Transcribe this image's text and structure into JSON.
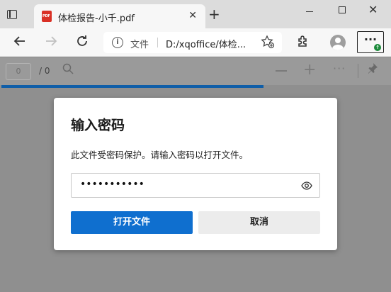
{
  "tab": {
    "title": "体检报告-小千.pdf",
    "icon": "pdf-icon",
    "icon_text": "PDF",
    "close": "✕"
  },
  "window": {
    "new_tab": "+",
    "close": "✕"
  },
  "address_bar": {
    "label": "文件",
    "url": "D:/xqoffice/体检..."
  },
  "toolbar": {
    "more": "···",
    "badge": "↑"
  },
  "pdf_toolbar": {
    "page_value": "0",
    "page_total": "/ 0",
    "more": "···",
    "progress": 0.67
  },
  "dialog": {
    "title": "输入密码",
    "message": "此文件受密码保护。请输入密码以打开文件。",
    "password_masked": "•••••••••••",
    "open_label": "打开文件",
    "cancel_label": "取消"
  },
  "colors": {
    "accent": "#0f6fcf",
    "progress": "#0f5ea8",
    "pdf_red": "#d93025"
  }
}
